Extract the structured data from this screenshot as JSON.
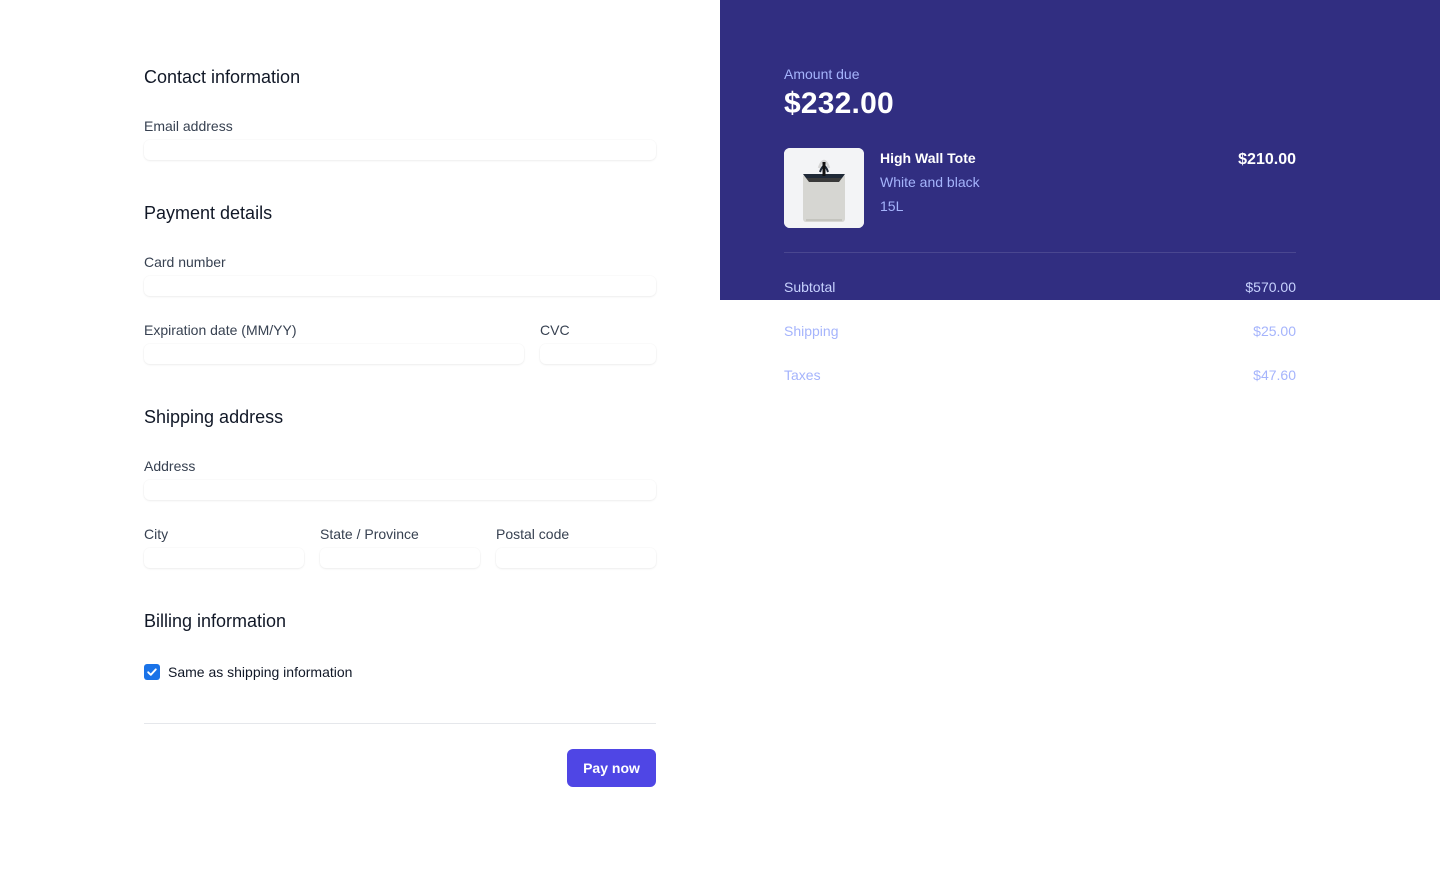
{
  "form": {
    "contact": {
      "title": "Contact information",
      "email_label": "Email address",
      "email_value": ""
    },
    "payment": {
      "title": "Payment details",
      "card_label": "Card number",
      "card_value": "",
      "expiry_label": "Expiration date (MM/YY)",
      "expiry_value": "",
      "cvc_label": "CVC",
      "cvc_value": ""
    },
    "shipping": {
      "title": "Shipping address",
      "address_label": "Address",
      "address_value": "",
      "city_label": "City",
      "city_value": "",
      "state_label": "State / Province",
      "state_value": "",
      "postal_label": "Postal code",
      "postal_value": ""
    },
    "billing": {
      "title": "Billing information",
      "same_as_shipping_label": "Same as shipping information",
      "same_as_shipping_checked": true
    },
    "pay_button_label": "Pay now"
  },
  "summary": {
    "amount_label": "Amount due",
    "amount_value": "$232.00",
    "product": {
      "image_icon": "tote-bag-image",
      "name": "High Wall Tote",
      "variant": "White and black",
      "size": "15L",
      "price": "$210.00"
    },
    "lines": {
      "subtotal_label": "Subtotal",
      "subtotal_value": "$570.00",
      "shipping_label": "Shipping",
      "shipping_value": "$25.00",
      "taxes_label": "Taxes",
      "taxes_value": "$47.60"
    }
  },
  "colors": {
    "summary_background": "#312e81",
    "accent_button": "#4f46e5",
    "muted_indigo_text": "#a5b4fc",
    "checkbox": "#1a73e8"
  }
}
